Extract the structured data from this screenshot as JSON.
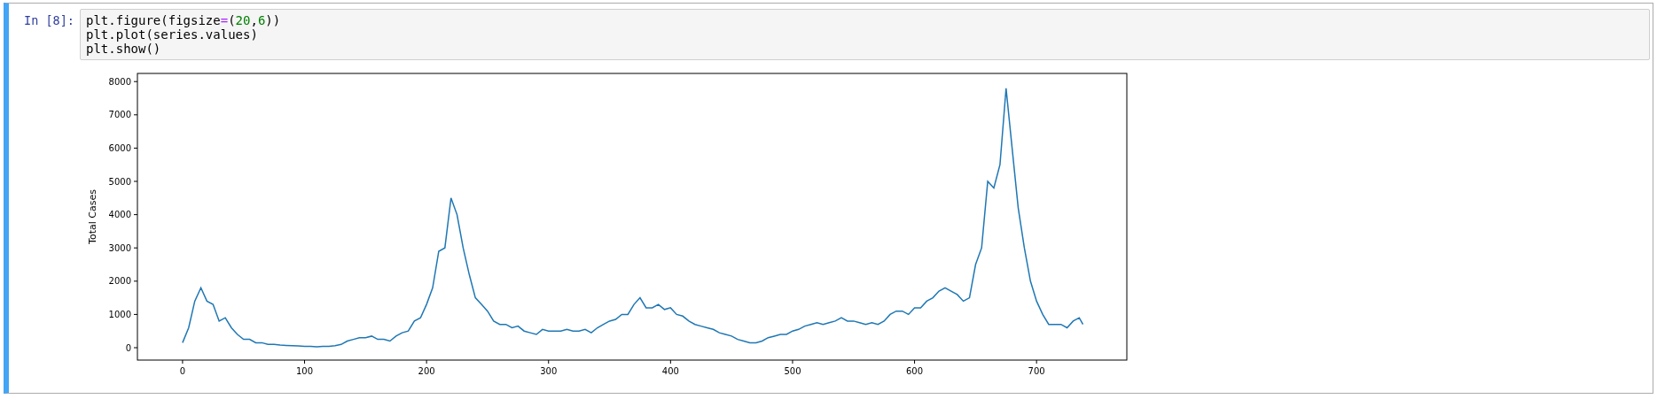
{
  "cell": {
    "prompt": "In [8]:",
    "selected": true,
    "code_lines": [
      [
        {
          "text": "plt.figure(figsize",
          "kind": "plain"
        },
        {
          "text": "=",
          "kind": "operator"
        },
        {
          "text": "(",
          "kind": "plain"
        },
        {
          "text": "20",
          "kind": "number"
        },
        {
          "text": ",",
          "kind": "plain"
        },
        {
          "text": "6",
          "kind": "number"
        },
        {
          "text": "))",
          "kind": "plain"
        }
      ],
      [
        {
          "text": "plt.plot(series.values)",
          "kind": "plain"
        }
      ],
      [
        {
          "text": "plt.show()",
          "kind": "plain"
        }
      ]
    ]
  },
  "output": {
    "chart_data": {
      "type": "line",
      "ylabel": "Total Cases",
      "xlim": [
        -37,
        774
      ],
      "ylim": [
        -372,
        8245
      ],
      "xticks": [
        0,
        100,
        200,
        300,
        400,
        500,
        600,
        700
      ],
      "yticks": [
        0,
        1000,
        2000,
        3000,
        4000,
        5000,
        6000,
        7000,
        8000
      ],
      "x": [
        0,
        5,
        10,
        15,
        20,
        25,
        30,
        35,
        40,
        45,
        50,
        55,
        60,
        65,
        70,
        75,
        80,
        85,
        90,
        95,
        100,
        105,
        110,
        115,
        120,
        125,
        130,
        135,
        140,
        145,
        150,
        155,
        160,
        165,
        170,
        175,
        180,
        185,
        190,
        195,
        200,
        205,
        210,
        215,
        220,
        225,
        230,
        235,
        240,
        245,
        250,
        255,
        260,
        265,
        270,
        275,
        280,
        285,
        290,
        295,
        300,
        305,
        310,
        315,
        320,
        325,
        330,
        335,
        340,
        345,
        350,
        355,
        360,
        365,
        370,
        375,
        380,
        385,
        390,
        395,
        400,
        405,
        410,
        415,
        420,
        425,
        430,
        435,
        440,
        445,
        450,
        455,
        460,
        465,
        470,
        475,
        480,
        485,
        490,
        495,
        500,
        505,
        510,
        515,
        520,
        525,
        530,
        535,
        540,
        545,
        550,
        555,
        560,
        565,
        570,
        575,
        580,
        585,
        590,
        595,
        600,
        605,
        610,
        615,
        620,
        625,
        630,
        635,
        640,
        645,
        650,
        655,
        660,
        665,
        670,
        675,
        680,
        685,
        690,
        695,
        700,
        705,
        710,
        715,
        720,
        725,
        730,
        735,
        738
      ],
      "series": [
        {
          "color": "#1f77b4",
          "values": [
            150,
            600,
            1400,
            1800,
            1400,
            1300,
            800,
            900,
            600,
            400,
            250,
            250,
            150,
            150,
            100,
            100,
            80,
            70,
            60,
            50,
            40,
            40,
            30,
            40,
            40,
            60,
            100,
            200,
            250,
            300,
            300,
            350,
            250,
            250,
            200,
            350,
            450,
            500,
            800,
            900,
            1300,
            1800,
            2900,
            3000,
            4500,
            4000,
            3000,
            2200,
            1500,
            1300,
            1100,
            800,
            700,
            700,
            600,
            650,
            500,
            450,
            400,
            550,
            500,
            500,
            500,
            550,
            500,
            500,
            550,
            450,
            600,
            700,
            800,
            850,
            1000,
            1000,
            1300,
            1500,
            1200,
            1200,
            1300,
            1150,
            1200,
            1000,
            950,
            800,
            700,
            650,
            600,
            550,
            450,
            400,
            350,
            250,
            200,
            150,
            150,
            200,
            300,
            350,
            400,
            400,
            500,
            550,
            650,
            700,
            750,
            700,
            750,
            800,
            900,
            800,
            800,
            750,
            700,
            750,
            700,
            800,
            1000,
            1100,
            1100,
            1000,
            1200,
            1200,
            1400,
            1500,
            1700,
            1800,
            1700,
            1600,
            1400,
            1500,
            2500,
            3000,
            5000,
            4800,
            5500,
            7800,
            6000,
            4200,
            3000,
            2000,
            1400,
            1000,
            700,
            700,
            700,
            600,
            800,
            900,
            700
          ]
        }
      ]
    }
  }
}
